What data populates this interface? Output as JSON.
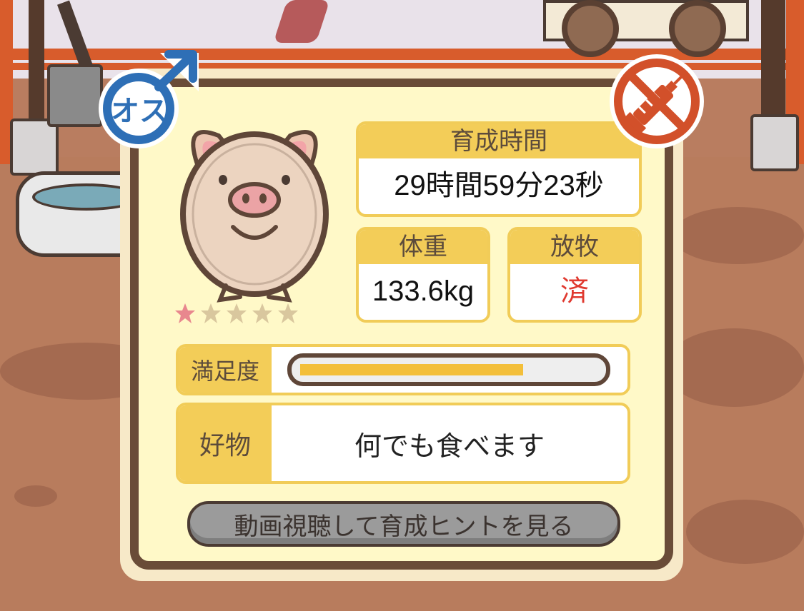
{
  "badges": {
    "gender_label": "オス",
    "male_color": "#2e6fb6",
    "medicine_color": "#d2502a"
  },
  "pig": {
    "rating_filled": 1,
    "rating_total": 5
  },
  "stats": {
    "time": {
      "label": "育成時間",
      "value": "29時間59分23秒"
    },
    "weight": {
      "label": "体重",
      "value": "133.6kg"
    },
    "grazing": {
      "label": "放牧",
      "value": "済"
    }
  },
  "satisfaction": {
    "label": "満足度",
    "level": 0.75
  },
  "favorite": {
    "label": "好物",
    "value": "何でも食べます"
  },
  "hint_button": {
    "label": "動画視聴して育成ヒントを見る"
  },
  "colors": {
    "panel_border": "#6a4c38",
    "header_yellow": "#f3cd58",
    "grazing_value": "#e0392f",
    "star_filled": "#e8878e",
    "star_empty": "#d9c79e"
  }
}
